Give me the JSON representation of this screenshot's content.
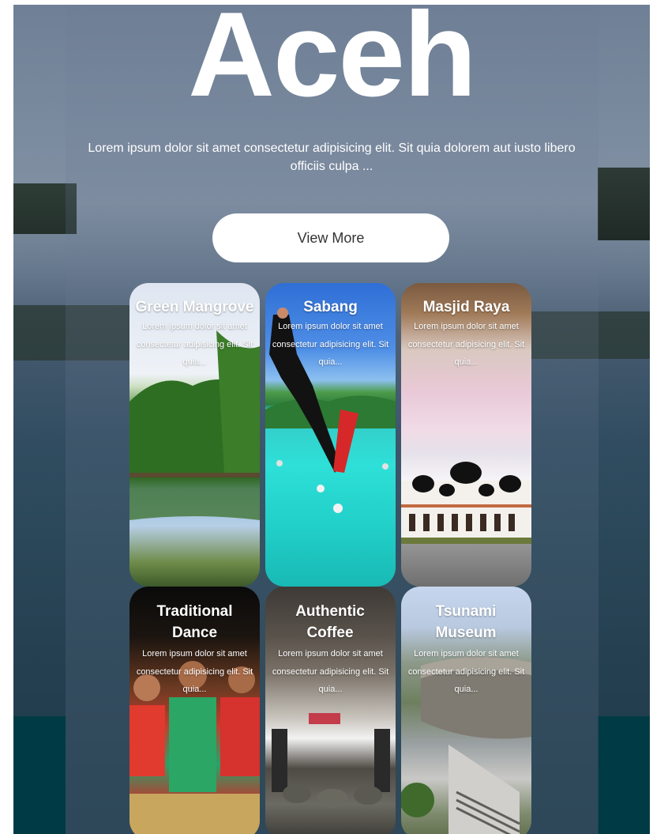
{
  "hero": {
    "title": "Aceh",
    "description": "Lorem ipsum dolor sit amet consectetur adipisicing elit. Sit quia dolorem aut iusto libero officiis culpa ...",
    "button_label": "View More"
  },
  "cards": [
    {
      "title": "Green Mangrove",
      "text": "Lorem ipsum dolor sit amet consectetur adipisicing elit. Sit quia..."
    },
    {
      "title": "Sabang",
      "text": "Lorem ipsum dolor sit amet consectetur adipisicing elit. Sit quia..."
    },
    {
      "title": "Masjid Raya",
      "text": "Lorem ipsum dolor sit amet consectetur adipisicing elit. Sit quia..."
    },
    {
      "title": "Traditional Dance",
      "text": "Lorem ipsum dolor sit amet consectetur adipisicing elit. Sit quia..."
    },
    {
      "title": "Authentic Coffee",
      "text": "Lorem ipsum dolor sit amet consectetur adipisicing elit. Sit quia..."
    },
    {
      "title": "Tsunami Museum",
      "text": "Lorem ipsum dolor sit amet consectetur adipisicing elit. Sit quia..."
    }
  ]
}
